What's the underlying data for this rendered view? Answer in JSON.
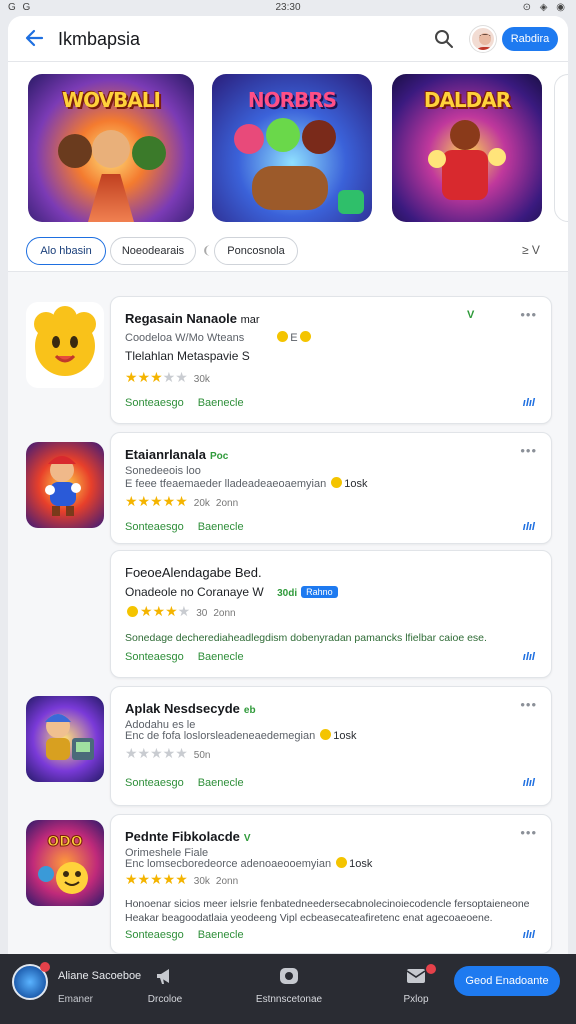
{
  "status_bar": {
    "left": "G G",
    "time": "23:30",
    "right": "⊙ ◈ ◉"
  },
  "header": {
    "title": "Ikmbapsia",
    "cta_label": "Rabdira",
    "back_icon": "arrow-left-icon",
    "search_icon": "search-icon"
  },
  "banners": [
    {
      "title": "WOVBALI"
    },
    {
      "title": "NORBRS"
    },
    {
      "title": "DALDAR"
    }
  ],
  "filters": {
    "chips": [
      "Alo hbasin",
      "Noeodearais",
      "Poncosnola"
    ],
    "sort_label": "≥ V"
  },
  "apps": [
    {
      "title": "Regasain Nanaole",
      "title_tag": "mar",
      "badge": "V",
      "line1": "Coodeloa W/Mo Wteans",
      "line1_extra": "E",
      "line2": "Tlelahlan Metaspavie S",
      "stars_on": 3,
      "stars_total": 5,
      "count": "30k",
      "link1": "Sonteaesgo",
      "link2": "Baenecle",
      "chart_icon": "ılıl"
    },
    {
      "title": "Etaianrlanala",
      "badge": "Poc",
      "line1": "Sonedeeois loo",
      "line2": "E feee tfeaemaeder lladeadeaeoaemyian",
      "line2_extra": "1osk",
      "stars_on": 5,
      "stars_total": 5,
      "count": "20k",
      "count2": "2onn",
      "link1": "Sonteaesgo",
      "link2": "Baenecle",
      "chart_icon": "ılıl"
    },
    {
      "title": "FoeoeAlendagabe Bed.",
      "line2": "Onadeole no Coranaye W",
      "line2_mid": "30di",
      "line2_pill": "Rahno",
      "stars_on": 4,
      "stars_total": 5,
      "count": "30",
      "count2": "2onn",
      "desc": "Sonedage decherediaheadlegdism dobenyradan pamancks lfielbar caioe ese.",
      "link1": "Sonteaesgo",
      "link2": "Baenecle",
      "chart_icon": "ılıl"
    },
    {
      "title": "Aplak Nesdsecyde",
      "badge": "eb",
      "line1": "Adodahu es le",
      "line2": "Enc de fofa loslorsleadeneaedemegian",
      "line2_extra": "1osk",
      "stars_on": 0,
      "stars_total": 5,
      "count": "50n",
      "link1": "Sonteaesgo",
      "link2": "Baenecle",
      "chart_icon": "ılıl"
    },
    {
      "title": "Pednte Fibkolacde",
      "badge": "V",
      "line1": "Orimeshele Fiale",
      "line2": "Enc lomsecboredeorce adenoaeooemyian",
      "line2_extra": "1osk",
      "stars_on": 5,
      "stars_total": 5,
      "count": "30k",
      "count2": "2onn",
      "desc": "Honoenar sicios meer ielsrie fenbatedneedersecabnolecinoiecodencle fersoptaieneone Heakar beagoodatlaia yeodeeng Vipl ecbeasecateafiretenc enat agecoaeoene.",
      "link1": "Sonteaesgo",
      "link2": "Baenecle",
      "chart_icon": "ılıl"
    }
  ],
  "bottom_bar": {
    "app_label": "Aliane Sacoeboe",
    "app_sub": "Emaner",
    "items": [
      "Drcoloe",
      "Estnnscetonae",
      "Pxlop"
    ],
    "cta": "Geod Enadoante",
    "accent": "#1e7af0"
  }
}
